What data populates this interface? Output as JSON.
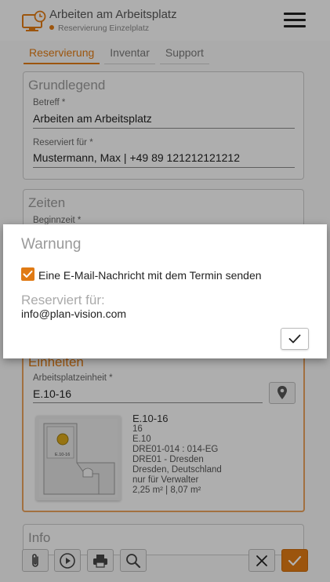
{
  "header": {
    "title": "Arbeiten am Arbeitsplatz",
    "subtitle": "Reservierung Einzelplatz",
    "app_icon": "desk-clock-icon",
    "menu_icon": "hamburger-menu-icon"
  },
  "tabs": [
    {
      "label": "Reservierung",
      "active": true
    },
    {
      "label": "Inventar",
      "active": false
    },
    {
      "label": "Support",
      "active": false
    }
  ],
  "grundlegend": {
    "title": "Grundlegend",
    "betreff_label": "Betreff *",
    "betreff_value": "Arbeiten am Arbeitsplatz",
    "reserviert_label": "Reserviert für *",
    "reserviert_value": "Mustermann, Max | +49 89 121212121212"
  },
  "zeiten": {
    "title": "Zeiten",
    "beginn_label": "Beginnzeit *"
  },
  "einheiten": {
    "title": "Einheiten",
    "unit_label": "Arbeitsplatzeinheit *",
    "unit_value": "E.10-16",
    "location_icon": "map-pin-icon",
    "plan_label": "E.10-16",
    "details": [
      "E.10-16",
      "16",
      "E.10",
      "DRE01-014 : 014-EG",
      "DRE01 - Dresden",
      "Dresden, Deutschland",
      "nur für Verwalter",
      "2,25 m² | 8,07 m²"
    ]
  },
  "info": {
    "title": "Info"
  },
  "toolbar": {
    "attach_icon": "paperclip-icon",
    "play_icon": "play-icon",
    "print_icon": "printer-icon",
    "search_icon": "search-icon",
    "cancel_icon": "close-icon",
    "confirm_icon": "checkmark-icon"
  },
  "dialog": {
    "title": "Warnung",
    "checkbox_label": "Eine E-Mail-Nachricht mit dem Termin senden",
    "checkbox_checked": true,
    "reserved_label": "Reserviert für:",
    "reserved_value": "info@plan-vision.com",
    "ok_icon": "checkmark-icon"
  },
  "colors": {
    "accent": "#e07a14",
    "overlay": "rgba(0,0,0,0.30)"
  }
}
